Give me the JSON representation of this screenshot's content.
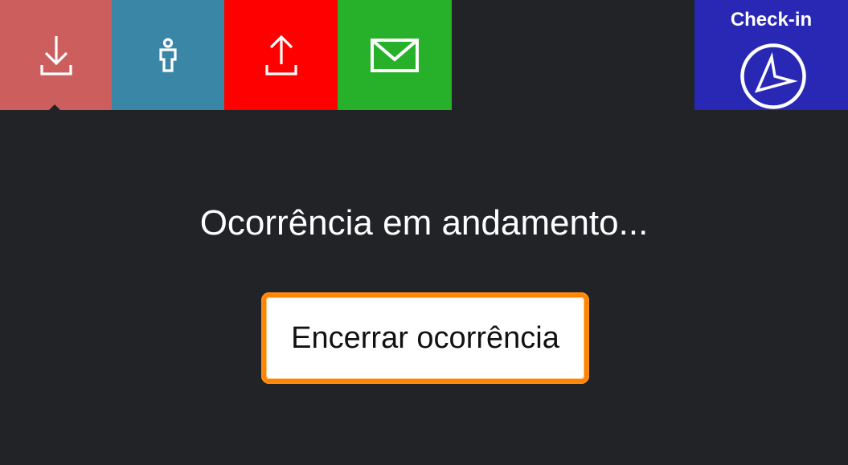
{
  "colors": {
    "background": "#222326",
    "download_tile": "#cc5e5d",
    "person_tile": "#3986a7",
    "upload_tile": "#ff0000",
    "mail_tile": "#27b12b",
    "checkin_tile": "#2828b4",
    "button_border": "#ff8400",
    "icon": "#ffffff"
  },
  "toolbar": {
    "tiles": [
      {
        "name": "download",
        "icon": "download-icon",
        "active": true
      },
      {
        "name": "person",
        "icon": "person-icon",
        "active": false
      },
      {
        "name": "upload",
        "icon": "upload-icon",
        "active": false
      },
      {
        "name": "mail",
        "icon": "mail-icon",
        "active": false
      }
    ],
    "checkin": {
      "label": "Check-in",
      "icon": "compass-arrow-icon"
    }
  },
  "main": {
    "status_text": "Ocorrência em andamento...",
    "end_button_label": "Encerrar ocorrência"
  }
}
